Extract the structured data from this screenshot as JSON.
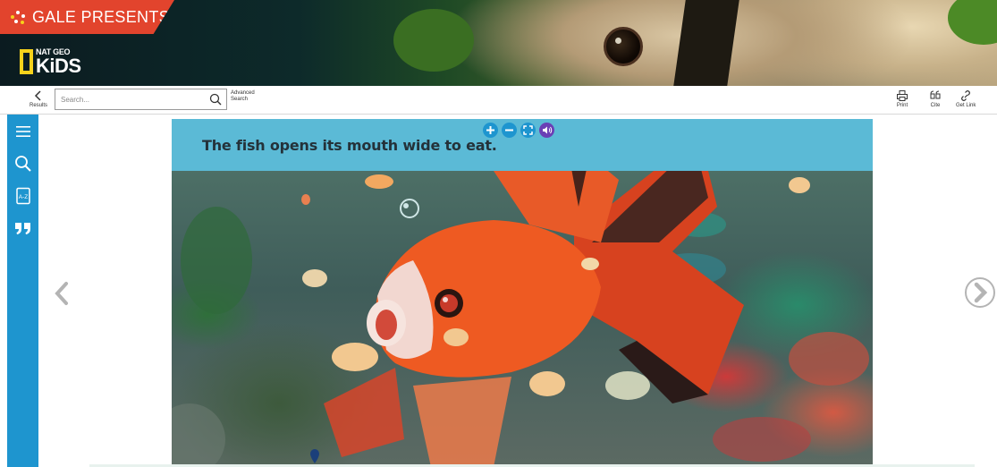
{
  "banner": {
    "gale_text": "GALE PRESENTS",
    "natgeo_small": "NAT GEO",
    "natgeo_kids": "KiDS"
  },
  "toolbar": {
    "back_label": "Results",
    "search_placeholder": "Search...",
    "advanced_line1": "Advanced",
    "advanced_line2": "Search",
    "print_label": "Print",
    "cite_label": "Cite",
    "getlink_label": "Get Link"
  },
  "sidebar": {
    "items": [
      {
        "icon": "hamburger-menu-icon"
      },
      {
        "icon": "search-icon"
      },
      {
        "icon": "a-z-index-icon"
      },
      {
        "icon": "quote-icon"
      }
    ]
  },
  "viewer": {
    "caption": "The fish opens its mouth wide to eat.",
    "controls": [
      "zoom-in-icon",
      "zoom-out-icon",
      "fit-screen-icon",
      "audio-icon"
    ]
  },
  "colors": {
    "accent_blue": "#1e95cf",
    "gale_red": "#e2442d",
    "natgeo_yellow": "#f7d21b",
    "caption_bg": "#5bbad6",
    "audio_purple": "#6a3fb5"
  }
}
